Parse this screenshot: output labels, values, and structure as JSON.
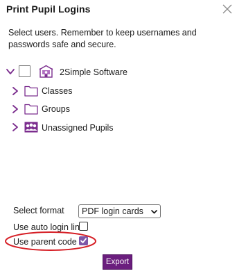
{
  "dialog": {
    "title": "Print Pupil Logins",
    "instructions": "Select users. Remember to keep usernames and passwords safe and secure."
  },
  "tree": {
    "root": {
      "label": "2Simple Software",
      "expanded": true,
      "checked": false,
      "icon": "school-icon"
    },
    "children": [
      {
        "label": "Classes",
        "icon": "folder-icon",
        "expanded": false
      },
      {
        "label": "Groups",
        "icon": "folder-icon",
        "expanded": false
      },
      {
        "label": "Unassigned Pupils",
        "icon": "pupils-icon",
        "expanded": false
      }
    ]
  },
  "form": {
    "select_format_label": "Select format",
    "select_format_value": "PDF login cards",
    "auto_login_label": "Use auto login links",
    "auto_login_checked": false,
    "parent_code_label": "Use parent code",
    "parent_code_checked": true
  },
  "actions": {
    "export_label": "Export"
  },
  "colors": {
    "accent": "#7e57a8",
    "button": "#6b1e7e",
    "highlight": "#d61f26"
  }
}
